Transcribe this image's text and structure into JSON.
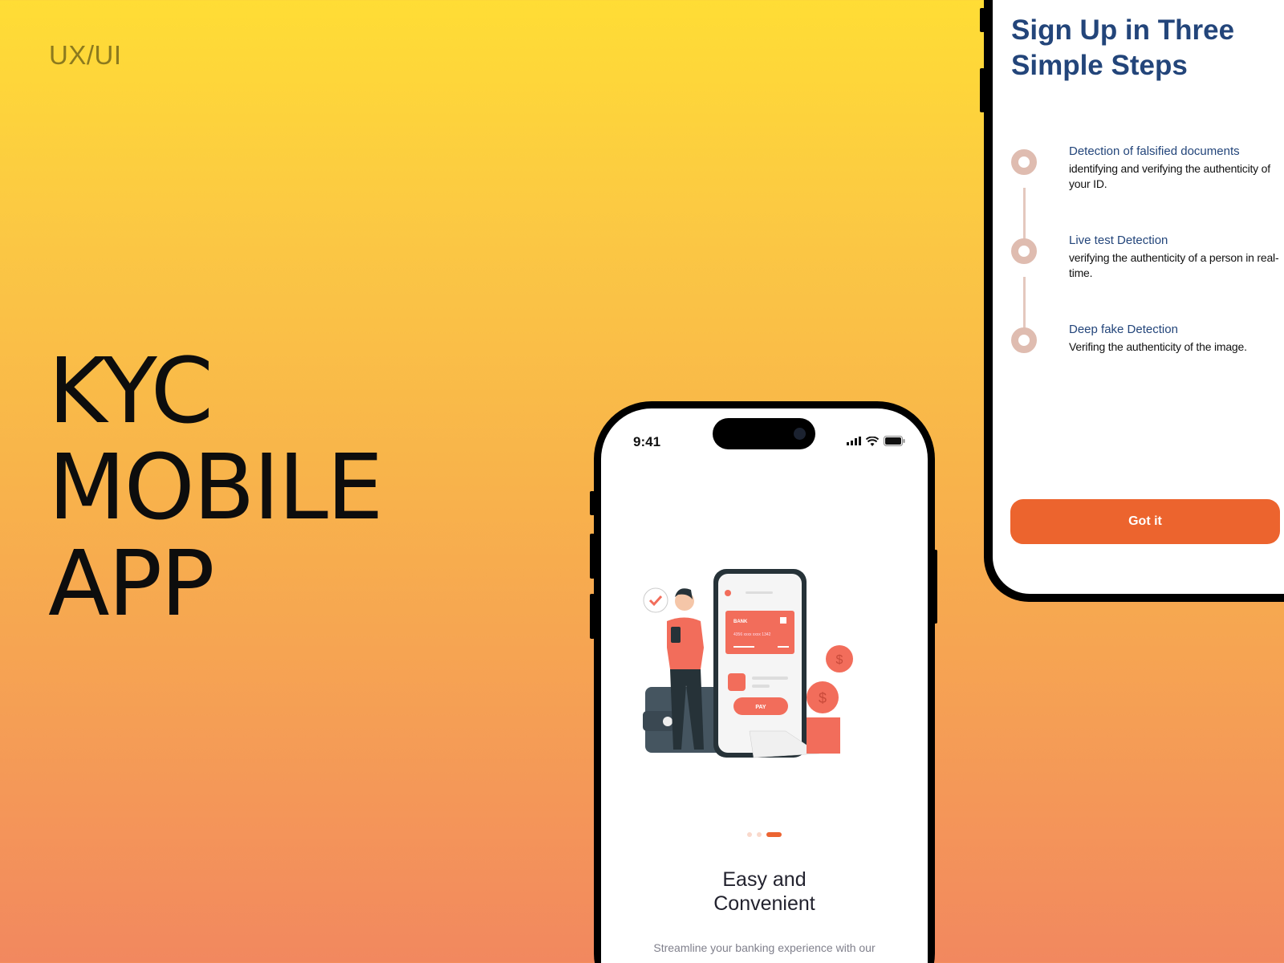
{
  "tag": "UX/UI",
  "hero": {
    "lines": [
      "KYC",
      "MOBILE",
      "APP"
    ]
  },
  "phone": {
    "status": {
      "time": "9:41"
    },
    "illustration": {
      "card_bank": "BANK",
      "card_number": [
        "4356",
        "xxxx",
        "xxxx",
        "1342"
      ],
      "pay_label": "PAY"
    },
    "carousel": {
      "total": 3,
      "active": 3
    },
    "title_line1": "Easy and",
    "title_line2": "Convenient",
    "description": "Streamline your banking experience with our"
  },
  "panel": {
    "title_line1": "Sign Up in Three",
    "title_line2": "Simple Steps",
    "steps": [
      {
        "title": "Detection of falsified documents",
        "desc": "identifying and verifying the authenticity of your ID."
      },
      {
        "title": "Live test Detection",
        "desc": "verifying the authenticity of a person in real-time."
      },
      {
        "title": "Deep fake Detection",
        "desc": "Verifing the authenticity of the image."
      }
    ],
    "button": "Got it"
  },
  "colors": {
    "accent": "#EC642E",
    "navy": "#23457A",
    "illustration": "#F26D5B"
  }
}
